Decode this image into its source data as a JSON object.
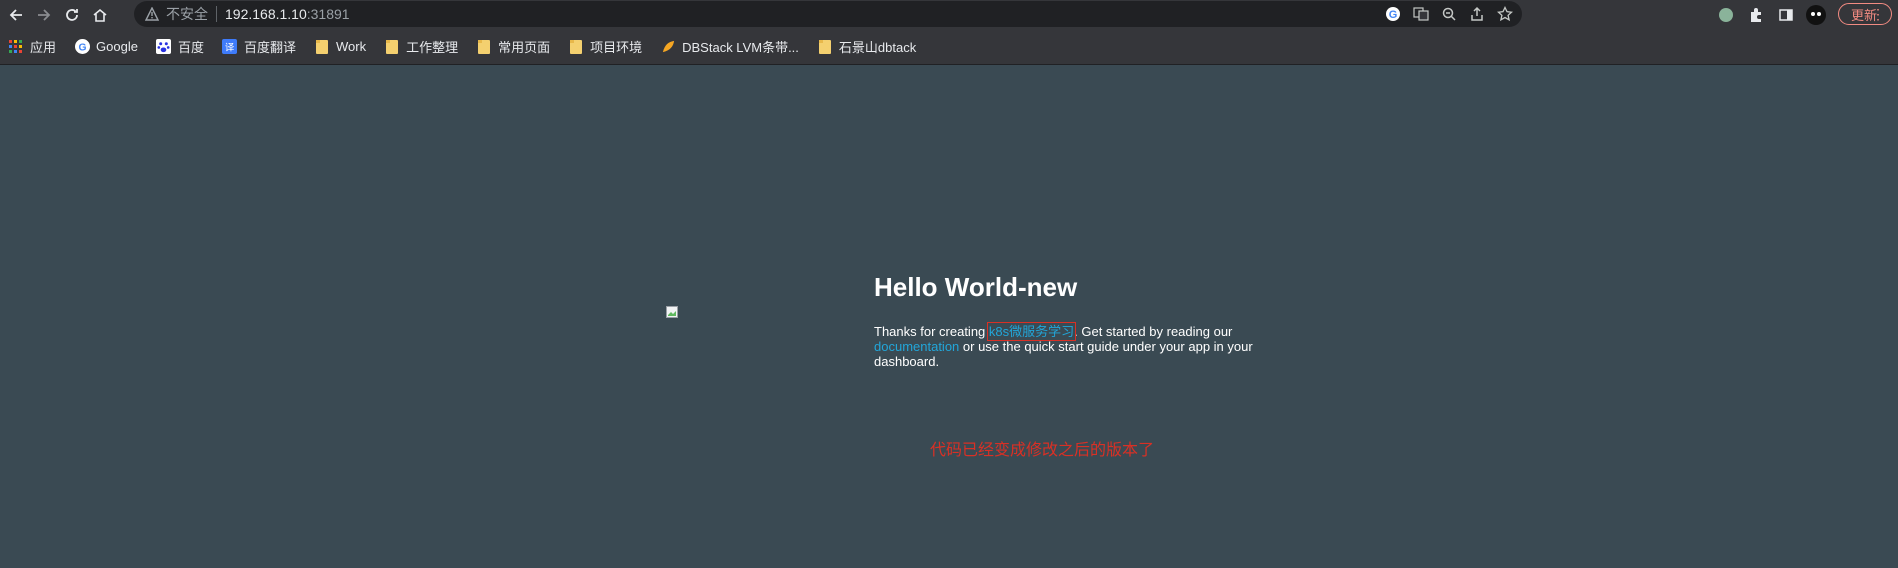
{
  "toolbar": {
    "security_label": "不安全",
    "url_host": "192.168.1.10",
    "url_port": ":31891",
    "update_label": "更新"
  },
  "bookmarks": [
    {
      "label": "应用",
      "icon": "apps-grid-icon"
    },
    {
      "label": "Google",
      "icon": "google-icon"
    },
    {
      "label": "百度",
      "icon": "baidu-icon"
    },
    {
      "label": "百度翻译",
      "icon": "translate-icon"
    },
    {
      "label": "Work",
      "icon": "folder-icon"
    },
    {
      "label": "工作整理",
      "icon": "folder-icon"
    },
    {
      "label": "常用页面",
      "icon": "folder-icon"
    },
    {
      "label": "项目环境",
      "icon": "folder-icon"
    },
    {
      "label": "DBStack LVM条带...",
      "icon": "bookmark-favicon-icon"
    },
    {
      "label": "石景山dbtack",
      "icon": "folder-icon"
    }
  ],
  "page": {
    "title": "Hello World-new",
    "desc_part1": "Thanks for creating ",
    "app_link": "k8s微服务学习",
    "desc_part2": ". Get started by reading our ",
    "docs_link": "documentation",
    "desc_part3": " or use the quick start guide under your app in your dashboard.",
    "note": "代码已经变成修改之后的版本了"
  },
  "colors": {
    "page_bg": "#3a4a53",
    "link": "#22a6d9",
    "note": "#d93025",
    "chrome_bg": "#35363a"
  }
}
